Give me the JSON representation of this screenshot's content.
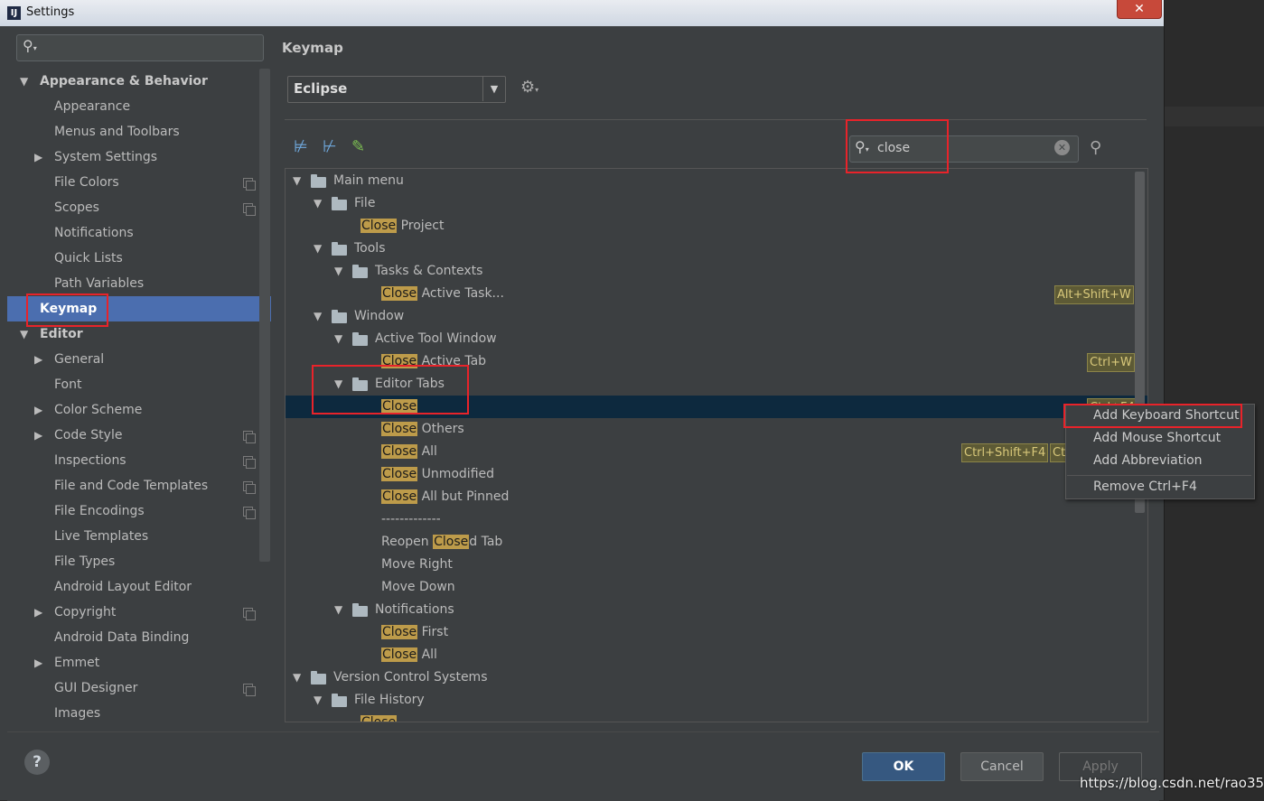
{
  "window": {
    "title": "Settings",
    "close_label": "✕"
  },
  "sidebar": {
    "items": [
      {
        "label": "Appearance & Behavior",
        "expanded": true
      },
      {
        "label": "Appearance"
      },
      {
        "label": "Menus and Toolbars"
      },
      {
        "label": "System Settings",
        "expandable": true
      },
      {
        "label": "File Colors",
        "project_icon": true
      },
      {
        "label": "Scopes",
        "project_icon": true
      },
      {
        "label": "Notifications"
      },
      {
        "label": "Quick Lists"
      },
      {
        "label": "Path Variables"
      },
      {
        "label": "Keymap",
        "selected": true
      },
      {
        "label": "Editor",
        "expanded": true
      },
      {
        "label": "General",
        "expandable": true
      },
      {
        "label": "Font"
      },
      {
        "label": "Color Scheme",
        "expandable": true
      },
      {
        "label": "Code Style",
        "expandable": true,
        "project_icon": true
      },
      {
        "label": "Inspections",
        "project_icon": true
      },
      {
        "label": "File and Code Templates",
        "project_icon": true
      },
      {
        "label": "File Encodings",
        "project_icon": true
      },
      {
        "label": "Live Templates"
      },
      {
        "label": "File Types"
      },
      {
        "label": "Android Layout Editor"
      },
      {
        "label": "Copyright",
        "expandable": true,
        "project_icon": true
      },
      {
        "label": "Android Data Binding"
      },
      {
        "label": "Emmet",
        "expandable": true
      },
      {
        "label": "GUI Designer",
        "project_icon": true
      },
      {
        "label": "Images"
      }
    ]
  },
  "keymap": {
    "title": "Keymap",
    "selected_keymap": "Eclipse",
    "filter_value": "close",
    "highlight_term": "Close",
    "tree": [
      {
        "pre": "",
        "hl": "",
        "post": "Main menu",
        "type": "root"
      },
      {
        "pre": "",
        "hl": "",
        "post": "File",
        "type": "folder"
      },
      {
        "pre": "",
        "hl": "Close",
        "post": " Project"
      },
      {
        "pre": "",
        "hl": "",
        "post": "Tools",
        "type": "folder"
      },
      {
        "pre": "",
        "hl": "",
        "post": "Tasks & Contexts",
        "type": "folder"
      },
      {
        "pre": "",
        "hl": "Close",
        "post": " Active Task...",
        "shortcuts": [
          "Alt+Shift+W"
        ]
      },
      {
        "pre": "",
        "hl": "",
        "post": "Window",
        "type": "folder"
      },
      {
        "pre": "",
        "hl": "",
        "post": "Active Tool Window",
        "type": "folder"
      },
      {
        "pre": "",
        "hl": "Close",
        "post": " Active Tab",
        "shortcuts": [
          "Ctrl+W"
        ]
      },
      {
        "pre": "",
        "hl": "",
        "post": "Editor Tabs",
        "type": "folder"
      },
      {
        "pre": "",
        "hl": "Close",
        "post": "",
        "selected": true,
        "shortcuts": [
          "Ctrl+F4"
        ]
      },
      {
        "pre": "",
        "hl": "Close",
        "post": " Others"
      },
      {
        "pre": "",
        "hl": "Close",
        "post": " All",
        "shortcuts": [
          "Ctrl+Shift+F4",
          "Ct"
        ]
      },
      {
        "pre": "",
        "hl": "Close",
        "post": " Unmodified"
      },
      {
        "pre": "",
        "hl": "Close",
        "post": " All but Pinned"
      },
      {
        "pre": "",
        "hl": "",
        "post": "-------------"
      },
      {
        "pre": "Reopen ",
        "hl": "Close",
        "post": "d Tab"
      },
      {
        "pre": "",
        "hl": "",
        "post": "Move Right"
      },
      {
        "pre": "",
        "hl": "",
        "post": "Move Down"
      },
      {
        "pre": "",
        "hl": "",
        "post": "Notifications",
        "type": "folder"
      },
      {
        "pre": "",
        "hl": "Close",
        "post": " First"
      },
      {
        "pre": "",
        "hl": "Close",
        "post": " All"
      },
      {
        "pre": "",
        "hl": "",
        "post": "Version Control Systems",
        "type": "folder"
      },
      {
        "pre": "",
        "hl": "",
        "post": "File History",
        "type": "folder"
      },
      {
        "pre": "",
        "hl": "Close",
        "post": ""
      }
    ]
  },
  "context_menu": {
    "items": [
      "Add Keyboard Shortcut",
      "Add Mouse Shortcut",
      "Add Abbreviation",
      "Remove Ctrl+F4"
    ]
  },
  "footer": {
    "help": "?",
    "ok": "OK",
    "cancel": "Cancel",
    "apply": "Apply"
  },
  "watermark": "https://blog.csdn.net/rao356",
  "colors": {
    "selection": "#4b6eaf",
    "highlight": "#bd9b4a",
    "annotation_box": "#e8232a",
    "ok_button": "#365880"
  }
}
